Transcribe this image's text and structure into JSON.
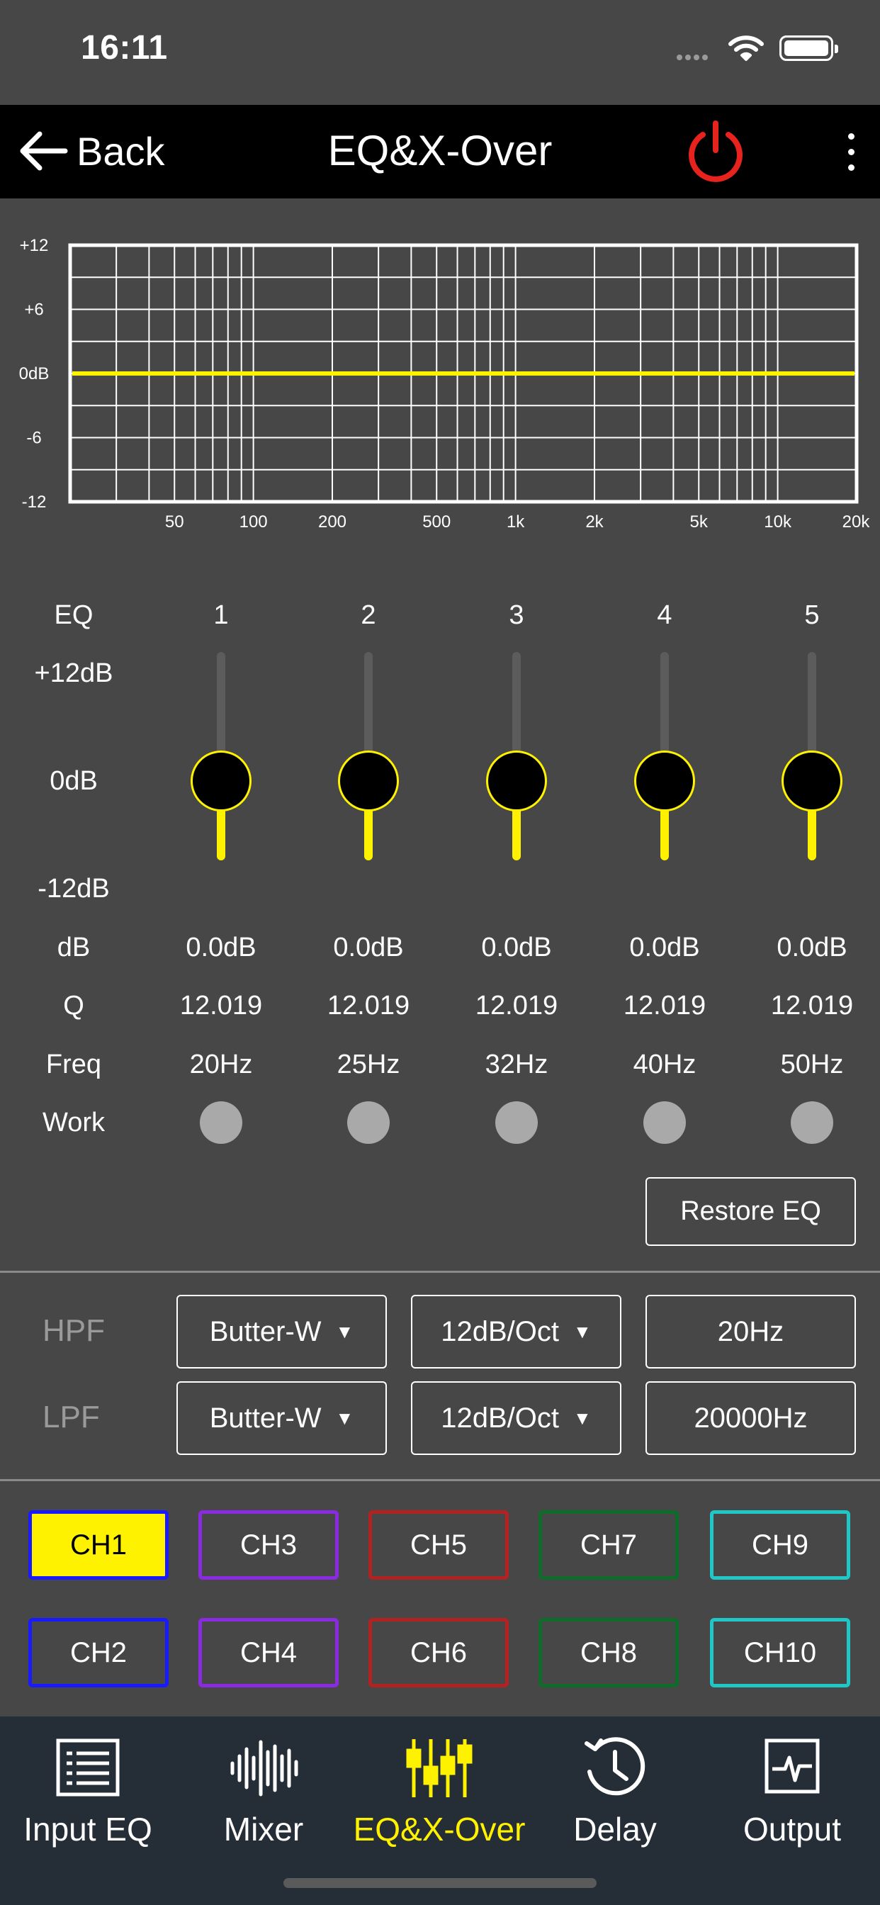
{
  "status": {
    "time": "16:11"
  },
  "header": {
    "back_label": "Back",
    "title": "EQ&X-Over"
  },
  "graph": {
    "y_labels": [
      "+12",
      "+6",
      "0dB",
      "-6",
      "-12"
    ],
    "x_labels": [
      "50",
      "100",
      "200",
      "500",
      "1k",
      "2k",
      "5k",
      "10k",
      "20k"
    ],
    "curve_db": 0,
    "curve_color": "#fff200"
  },
  "eq": {
    "row_labels": {
      "eq": "EQ",
      "max": "+12dB",
      "mid": "0dB",
      "min": "-12dB",
      "db": "dB",
      "q": "Q",
      "freq": "Freq",
      "work": "Work"
    },
    "bands": [
      {
        "num": "1",
        "db": "0.0dB",
        "q": "12.019",
        "freq": "20Hz"
      },
      {
        "num": "2",
        "db": "0.0dB",
        "q": "12.019",
        "freq": "25Hz"
      },
      {
        "num": "3",
        "db": "0.0dB",
        "q": "12.019",
        "freq": "32Hz"
      },
      {
        "num": "4",
        "db": "0.0dB",
        "q": "12.019",
        "freq": "40Hz"
      },
      {
        "num": "5",
        "db": "0.0dB",
        "q": "12.019",
        "freq": "50Hz"
      }
    ],
    "restore_label": "Restore EQ"
  },
  "filters": {
    "hpf": {
      "label": "HPF",
      "type": "Butter-W",
      "slope": "12dB/Oct",
      "freq": "20Hz"
    },
    "lpf": {
      "label": "LPF",
      "type": "Butter-W",
      "slope": "12dB/Oct",
      "freq": "20000Hz"
    }
  },
  "channels": [
    {
      "label": "CH1",
      "color": "#1a1aff",
      "active": true
    },
    {
      "label": "CH3",
      "color": "#8a2be2",
      "active": false
    },
    {
      "label": "CH5",
      "color": "#b22222",
      "active": false
    },
    {
      "label": "CH7",
      "color": "#0f6b2a",
      "active": false
    },
    {
      "label": "CH9",
      "color": "#1fc7c7",
      "active": false
    },
    {
      "label": "CH2",
      "color": "#1a1aff",
      "active": false
    },
    {
      "label": "CH4",
      "color": "#8a2be2",
      "active": false
    },
    {
      "label": "CH6",
      "color": "#b22222",
      "active": false
    },
    {
      "label": "CH8",
      "color": "#0f6b2a",
      "active": false
    },
    {
      "label": "CH10",
      "color": "#1fc7c7",
      "active": false
    }
  ],
  "tabs": [
    {
      "label": "Input EQ",
      "icon": "list-icon",
      "active": false
    },
    {
      "label": "Mixer",
      "icon": "waveform-icon",
      "active": false
    },
    {
      "label": "EQ&X-Over",
      "icon": "sliders-icon",
      "active": true
    },
    {
      "label": "Delay",
      "icon": "clock-icon",
      "active": false
    },
    {
      "label": "Output",
      "icon": "output-icon",
      "active": false
    }
  ],
  "colors": {
    "accent": "#fff200",
    "power": "#e8231e",
    "background": "#474747",
    "tabbar": "#252d37"
  }
}
